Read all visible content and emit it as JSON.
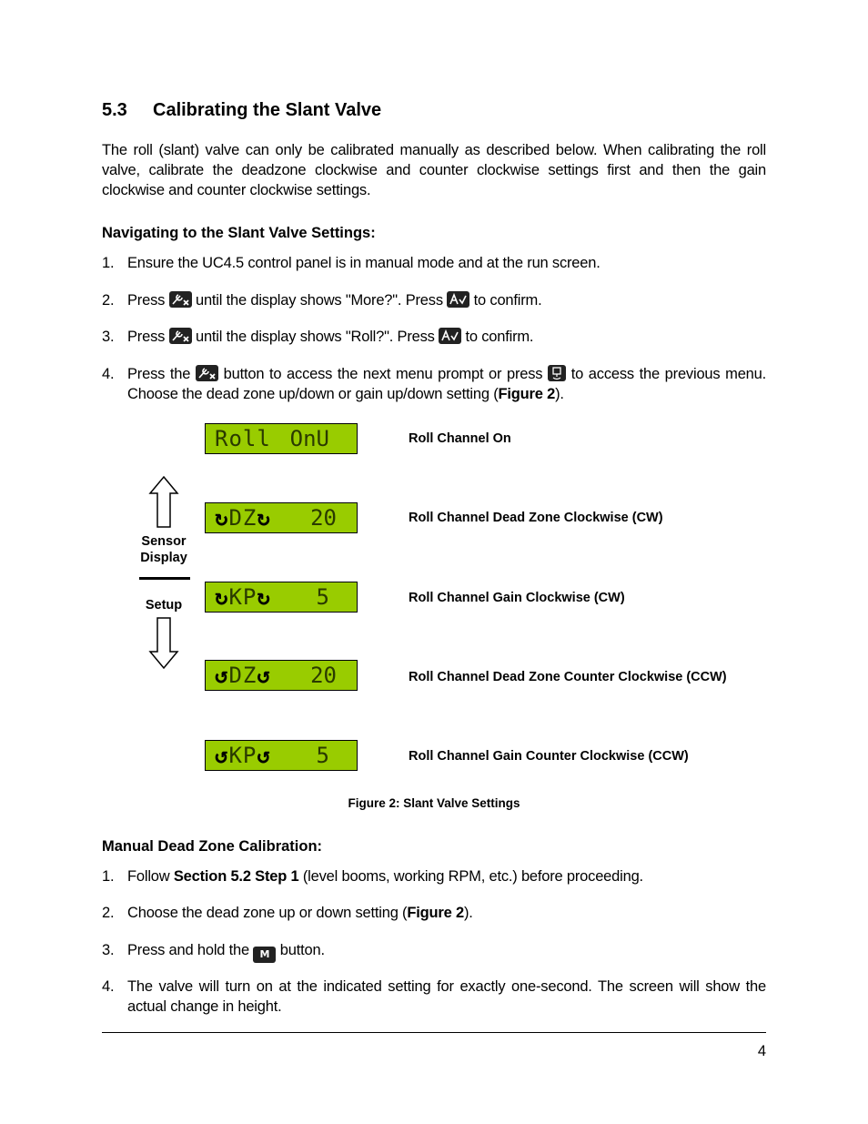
{
  "section": {
    "number": "5.3",
    "title": "Calibrating the Slant Valve"
  },
  "intro": "The roll (slant) valve can only be calibrated manually as described below.  When calibrating the roll valve, calibrate the deadzone clockwise and counter clockwise settings first and then the gain clockwise and counter clockwise settings.",
  "navigating": {
    "heading": "Navigating to the Slant Valve Settings:",
    "steps": [
      {
        "num": "1.",
        "text": "Ensure the UC4.5 control panel is in manual mode and at the run screen."
      },
      {
        "num": "2.",
        "pre": "Press",
        "mid": "until the display shows \"More?\".  Press",
        "post": "to confirm."
      },
      {
        "num": "3.",
        "pre": "Press",
        "mid": "until the display shows \"Roll?\".  Press",
        "post": "to confirm."
      },
      {
        "num": "4.",
        "pre": "Press the",
        "mid": "button to access the next menu prompt or press",
        "post": "to access the previous menu.  Choose the dead zone up/down or gain up/down setting (",
        "bold": "Figure 2",
        "end": ")."
      }
    ]
  },
  "icons": {
    "setup_key": "wrench-x-key-icon",
    "confirm_key": "av-confirm-key-icon",
    "sensor_key": "sensor-display-key-icon",
    "manual_key": "M",
    "manual_key_icon": "m-key-icon"
  },
  "figure": {
    "screens": [
      {
        "left": "Roll",
        "right": "OnU",
        "label": "Roll Channel On"
      },
      {
        "arrow": "cw",
        "left": "DZ",
        "right": "20",
        "label": "Roll Channel Dead Zone Clockwise (CW)"
      },
      {
        "arrow": "cw",
        "left": "KP",
        "right": "5",
        "label": "Roll Channel Gain Clockwise (CW)"
      },
      {
        "arrow": "ccw",
        "left": "DZ",
        "right": "20",
        "label": "Roll Channel Dead Zone Counter Clockwise (CCW)"
      },
      {
        "arrow": "ccw",
        "left": "KP",
        "right": "5",
        "label": "Roll Channel Gain Counter Clockwise (CCW)"
      }
    ],
    "up_label_line1": "Sensor",
    "up_label_line2": "Display",
    "down_label": "Setup",
    "caption": "Figure 2:  Slant Valve Settings",
    "lcd_color": "#99cc00"
  },
  "manual": {
    "heading": "Manual Dead Zone Calibration:",
    "steps": [
      {
        "num": "1.",
        "pre": "Follow ",
        "bold": "Section 5.2 Step 1",
        "post": " (level booms, working RPM, etc.) before proceeding."
      },
      {
        "num": "2.",
        "pre": "Choose the dead zone up or down setting (",
        "bold": "Figure 2",
        "post": ")."
      },
      {
        "num": "3.",
        "pre": "Press and hold the",
        "post": "button."
      },
      {
        "num": "4.",
        "text": "The valve will turn on at the indicated setting for exactly one-second.  The screen will show the actual change in height."
      }
    ]
  },
  "page_number": "4"
}
